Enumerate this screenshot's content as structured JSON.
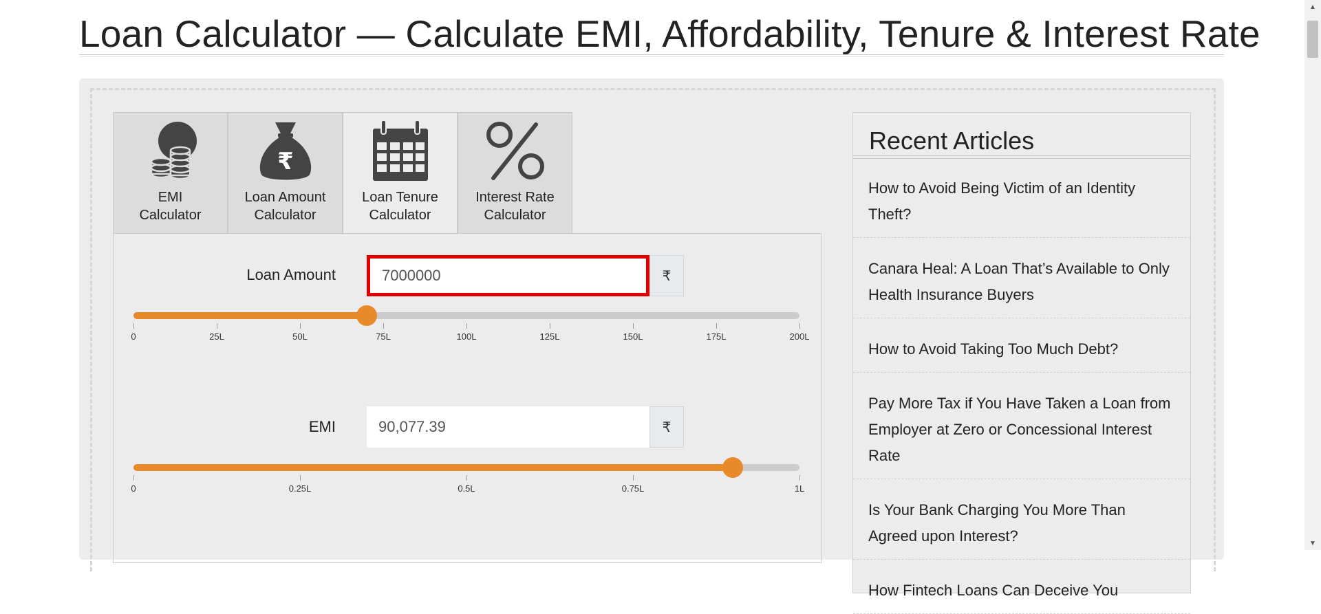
{
  "page": {
    "title": "Loan Calculator — Calculate EMI, Affordability, Tenure & Interest Rate"
  },
  "tabs": [
    {
      "label_line1": "EMI",
      "label_line2": "Calculator",
      "icon": "coins-icon",
      "active": false
    },
    {
      "label_line1": "Loan Amount",
      "label_line2": "Calculator",
      "icon": "money-bag-icon",
      "active": false
    },
    {
      "label_line1": "Loan Tenure",
      "label_line2": "Calculator",
      "icon": "calendar-icon",
      "active": true
    },
    {
      "label_line1": "Interest Rate",
      "label_line2": "Calculator",
      "icon": "percent-icon",
      "active": false
    }
  ],
  "calculator": {
    "loan_amount": {
      "label": "Loan Amount",
      "value": "7000000",
      "currency": "₹",
      "slider_fraction": 0.35,
      "ticks": [
        "0",
        "25L",
        "50L",
        "75L",
        "100L",
        "125L",
        "150L",
        "175L",
        "200L"
      ]
    },
    "emi": {
      "label": "EMI",
      "value": "90,077.39",
      "currency": "₹",
      "slider_fraction": 0.9,
      "ticks": [
        "0",
        "0.25L",
        "0.5L",
        "0.75L",
        "1L"
      ]
    }
  },
  "sidebar": {
    "title": "Recent Articles",
    "articles": [
      "How to Avoid Being Victim of an Identity Theft?",
      "Canara Heal: A Loan That’s Available to Only Health Insurance Buyers",
      "How to Avoid Taking Too Much Debt?",
      "Pay More Tax if You Have Taken a Loan from Employer at Zero or Concessional Interest Rate",
      "Is Your Bank Charging You More Than Agreed upon Interest?",
      "How Fintech Loans Can Deceive You"
    ]
  },
  "colors": {
    "accent": "#e8892a",
    "highlight_border": "#e00000",
    "panel_bg": "#ececec",
    "tab_bg": "#dcdcdc"
  }
}
